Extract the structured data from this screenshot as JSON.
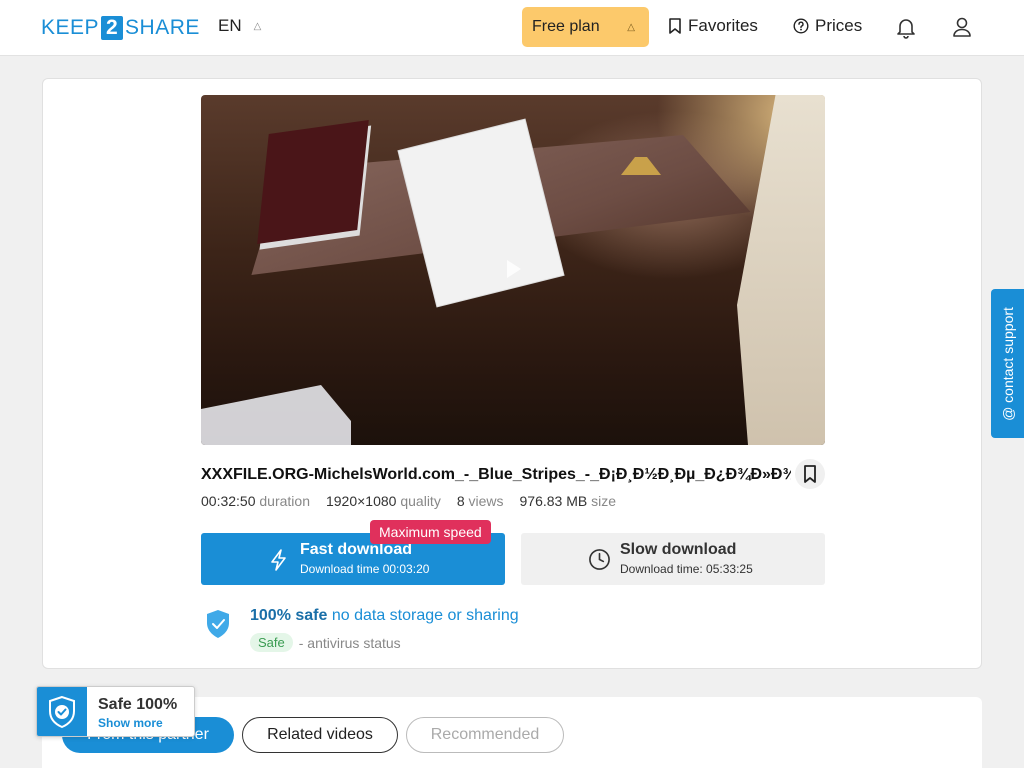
{
  "header": {
    "logo_left": "KEEP",
    "logo_mid": "2",
    "logo_right": "SHARE",
    "language": "EN",
    "plan_label": "Free plan",
    "favorites_label": "Favorites",
    "prices_label": "Prices"
  },
  "file": {
    "title": "XXXFILE.ORG-MichelsWorld.com_-_Blue_Stripes_-_Ð¡Ð¸Ð½Ð¸Ðµ_Ð¿Ð¾Ð»Ð¾...",
    "duration": "00:32:50",
    "duration_label": "duration",
    "quality": "1920×1080",
    "quality_label": "quality",
    "views": "8",
    "views_label": "views",
    "size": "976.83 MB",
    "size_label": "size"
  },
  "download": {
    "fast_label": "Fast download",
    "fast_time": "Download time 00:03:20",
    "badge": "Maximum speed",
    "slow_label": "Slow download",
    "slow_time": "Download time: 05:33:25"
  },
  "safety": {
    "headline_strong": "100% safe",
    "headline_rest": "no data storage or sharing",
    "status_pill": "Safe",
    "status_text": "- antivirus status"
  },
  "support": {
    "label": "@ contact support"
  },
  "tabs": {
    "partner": "From this partner",
    "related": "Related videos",
    "recommended": "Recommended"
  },
  "safe_badge": {
    "title": "Safe 100%",
    "link": "Show more"
  },
  "colors": {
    "accent": "#1a8ed6",
    "plan_button": "#fcc96b",
    "badge": "#e0305c"
  }
}
